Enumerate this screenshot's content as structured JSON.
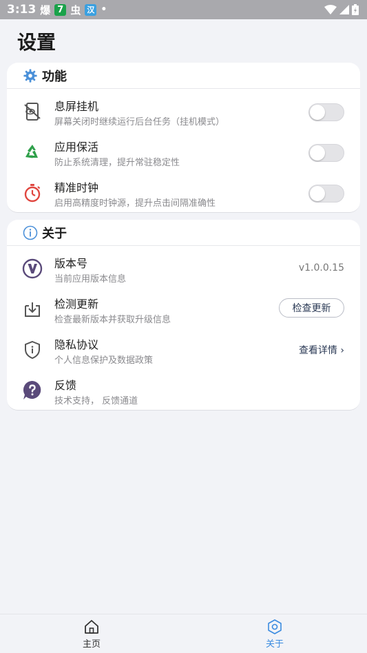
{
  "status_bar": {
    "time": "3:13",
    "notif_app1": "爆",
    "notif_app2": "7",
    "notif_app3": "虫",
    "notif_app4": "汉",
    "notif_dot": "•"
  },
  "page": {
    "title": "设置"
  },
  "function_section": {
    "title": "功能",
    "items": [
      {
        "title": "息屏挂机",
        "subtitle": "屏幕关闭时继续运行后台任务（挂机模式）",
        "icon": "screen-off-icon",
        "enabled": false
      },
      {
        "title": "应用保活",
        "subtitle": "防止系统清理，提升常驻稳定性",
        "icon": "recycle-icon",
        "enabled": false
      },
      {
        "title": "精准时钟",
        "subtitle": "启用高精度时钟源，提升点击间隔准确性",
        "icon": "timer-icon",
        "enabled": false
      }
    ]
  },
  "about_section": {
    "title": "关于",
    "version": {
      "title": "版本号",
      "subtitle": "当前应用版本信息",
      "value": "v1.0.0.15"
    },
    "update": {
      "title": "检测更新",
      "subtitle": "检查最新版本并获取升级信息",
      "button_label": "检查更新"
    },
    "privacy": {
      "title": "隐私协议",
      "subtitle": "个人信息保护及数据政策",
      "link_label": "查看详情 ›"
    },
    "feedback": {
      "title": "反馈",
      "subtitle": "技术支持， 反馈通道"
    }
  },
  "bottom_nav": {
    "items": [
      {
        "label": "主页",
        "active": false
      },
      {
        "label": "关于",
        "active": true
      }
    ]
  },
  "colors": {
    "accent": "#3b8be0",
    "background": "#f2f3f7",
    "status_bar": "#a9a9ad",
    "recycle_green": "#2fa04a",
    "timer_red": "#e0463f",
    "icon_purple": "#5a4a7a"
  }
}
